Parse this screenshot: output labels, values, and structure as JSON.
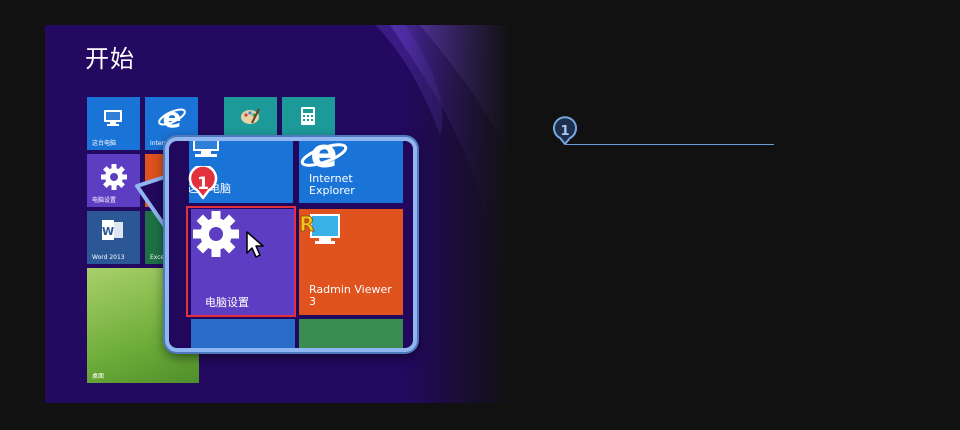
{
  "start": {
    "title": "开始"
  },
  "tiles": {
    "my_computer": "这台电脑",
    "internet_explorer_small": "Internet Explorer",
    "pc_settings_small": "电脑设置",
    "word": "Word 2013",
    "excel_small": "Excel",
    "desktop": "桌面"
  },
  "callout": {
    "top_left_label": "这台电脑",
    "ie_label_line1": "Internet",
    "ie_label_line2": "Explorer",
    "settings_label": "电脑设置",
    "radmin_line1": "Radmin Viewer",
    "radmin_line2": "3",
    "step_number": "1"
  },
  "annotation": {
    "step_number": "1"
  },
  "colors": {
    "start_bg": "#23095f",
    "settings_tile": "#5d3dc2",
    "blue_tile": "#1a73d6",
    "orange_tile": "#e0521e",
    "teal_tile": "#1c9a9a",
    "green_tile": "#3a8c52",
    "highlight": "#e3303d",
    "callout_border": "#8fb6f0"
  },
  "icons": [
    "computer-icon",
    "ie-icon",
    "gear-icon",
    "word-icon",
    "paint-icon",
    "calculator-icon",
    "radmin-icon",
    "cursor-icon"
  ]
}
